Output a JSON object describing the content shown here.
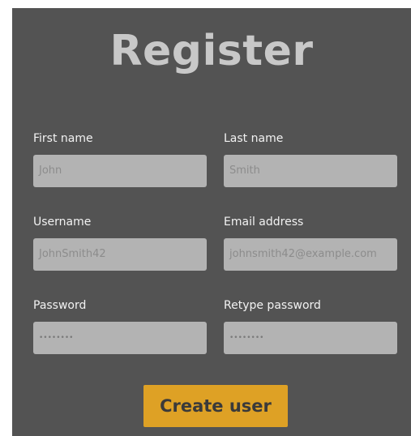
{
  "form": {
    "title": "Register",
    "fields": {
      "first_name": {
        "label": "First name",
        "value": "John"
      },
      "last_name": {
        "label": "Last name",
        "value": "Smith"
      },
      "username": {
        "label": "Username",
        "value": "JohnSmith42"
      },
      "email": {
        "label": "Email address",
        "value": "johnsmith42@example.com"
      },
      "password": {
        "label": "Password",
        "value": "••••••••"
      },
      "retype_password": {
        "label": "Retype password",
        "value": "••••••••"
      }
    },
    "submit_label": "Create user"
  },
  "colors": {
    "panel_background": "#535353",
    "title": "#c8c8c8",
    "label": "#f2f2f2",
    "input_background": "#b3b3b3",
    "input_text": "#8c8c8c",
    "button_background": "#dea125",
    "button_text": "#3a3a3a"
  }
}
